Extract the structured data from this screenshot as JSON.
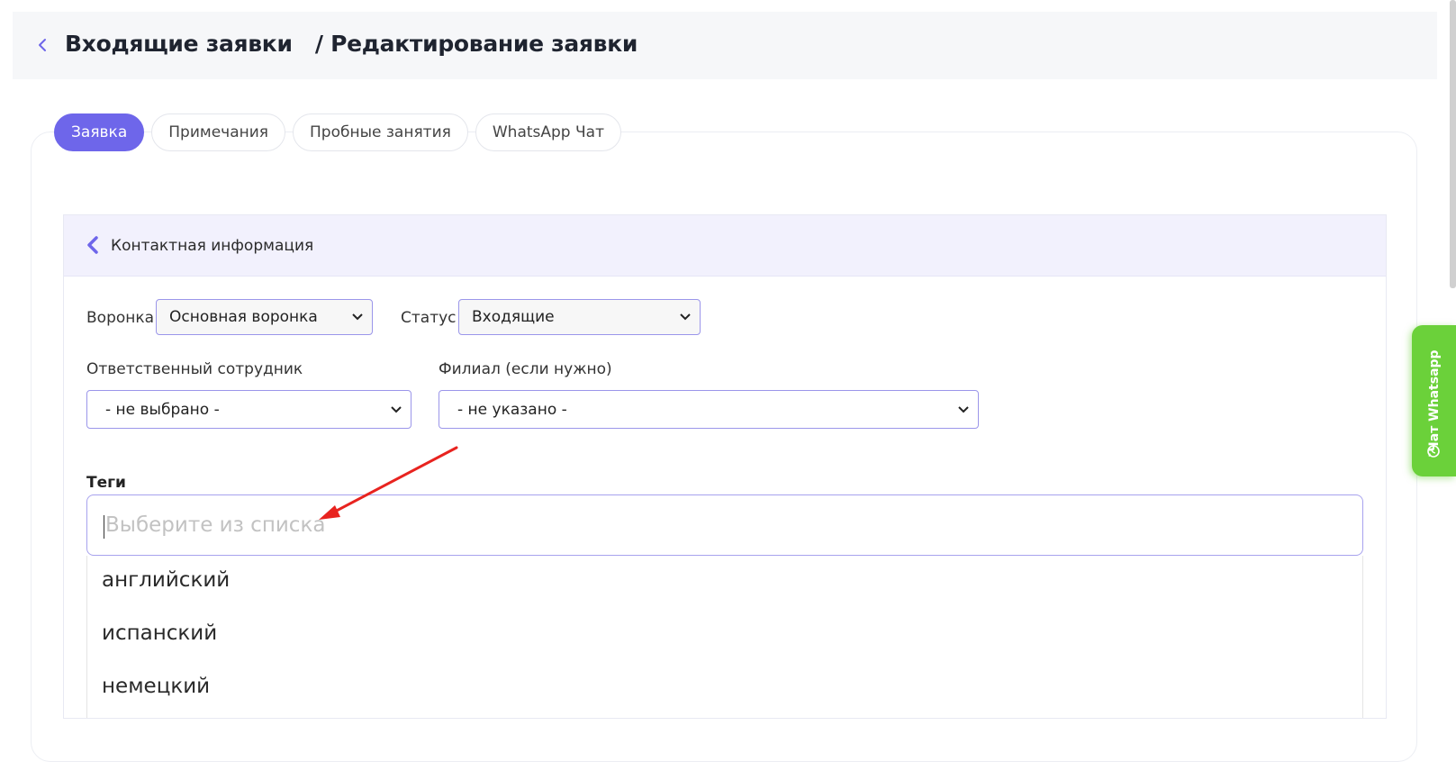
{
  "header": {
    "back_icon": "chevron-left-icon",
    "title": "Входящие заявки   / Редактирование заявки"
  },
  "tabs": [
    {
      "label": "Заявка",
      "active": true
    },
    {
      "label": "Примечания",
      "active": false
    },
    {
      "label": "Пробные занятия",
      "active": false
    },
    {
      "label": "WhatsApp Чат",
      "active": false
    }
  ],
  "section": {
    "icon": "chevron-left-icon",
    "title": "Контактная информация"
  },
  "form": {
    "funnel_label": "Воронка",
    "funnel_value": "Основная воронка",
    "status_label": "Статус",
    "status_value": "Входящие",
    "responsible_label": "Ответственный сотрудник",
    "responsible_value": "- не выбрано -",
    "branch_label": "Филиал (если нужно)",
    "branch_value": "- не указано -",
    "tags_label": "Теги",
    "tags_placeholder": "Выберите из списка",
    "tag_options": [
      "английский",
      "испанский",
      "немецкий"
    ]
  },
  "whatsapp_widget": {
    "label": "Чат Whatsapp",
    "icon": "whatsapp-icon",
    "color": "#6bd13a"
  },
  "colors": {
    "accent": "#6e66ea",
    "annotation_arrow": "#e8231f"
  }
}
